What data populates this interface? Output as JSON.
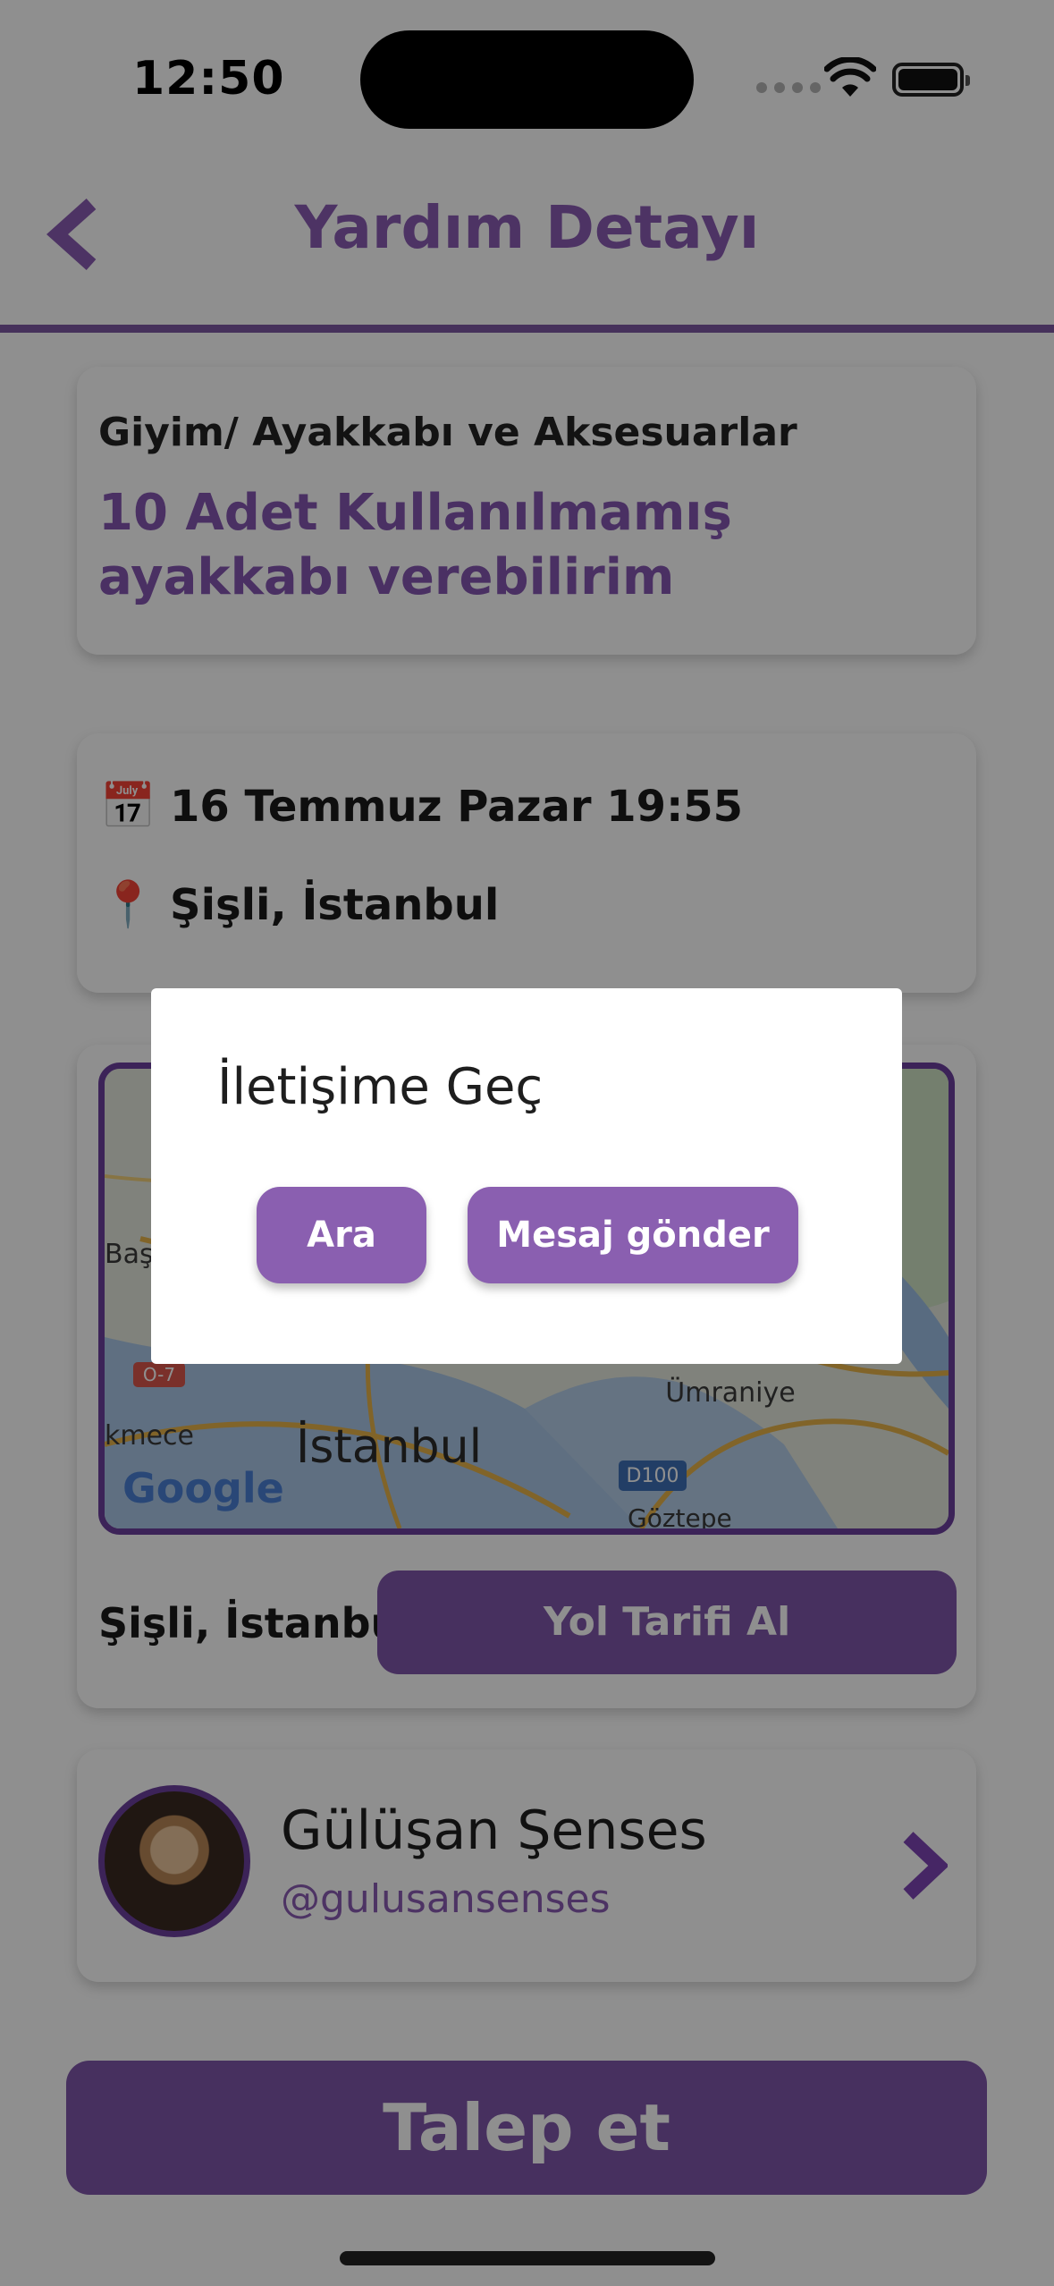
{
  "status_bar": {
    "time": "12:50"
  },
  "header": {
    "title": "Yardım Detayı"
  },
  "help_card": {
    "category": "Giyim/ Ayakkabı ve Aksesuarlar",
    "headline": "10 Adet Kullanılmamış ayakkabı verebilirim"
  },
  "info_card": {
    "date": "16 Temmuz Pazar 19:55",
    "location": "Şişli, İstanbul"
  },
  "map_card": {
    "map_labels": {
      "city": "İstanbul",
      "district1": "Ümraniye",
      "district2": "Göztepe",
      "left1": "Başa",
      "left2": "kmece",
      "road": "D100",
      "road2": "O-7",
      "google": "Google"
    },
    "location": "Şişli, İstanbul",
    "route_button": "Yol Tarifi Al"
  },
  "user_card": {
    "name": "Gülüşan Şenses",
    "handle": "@gulusansenses"
  },
  "request_button": "Talep et",
  "dialog": {
    "title": "İletişime Geç",
    "call_button": "Ara",
    "message_button": "Mesaj gönder"
  },
  "colors": {
    "accent": "#8a5cb2",
    "button": "#7f56aa",
    "overlay": "rgba(0,0,0,0.44)"
  }
}
